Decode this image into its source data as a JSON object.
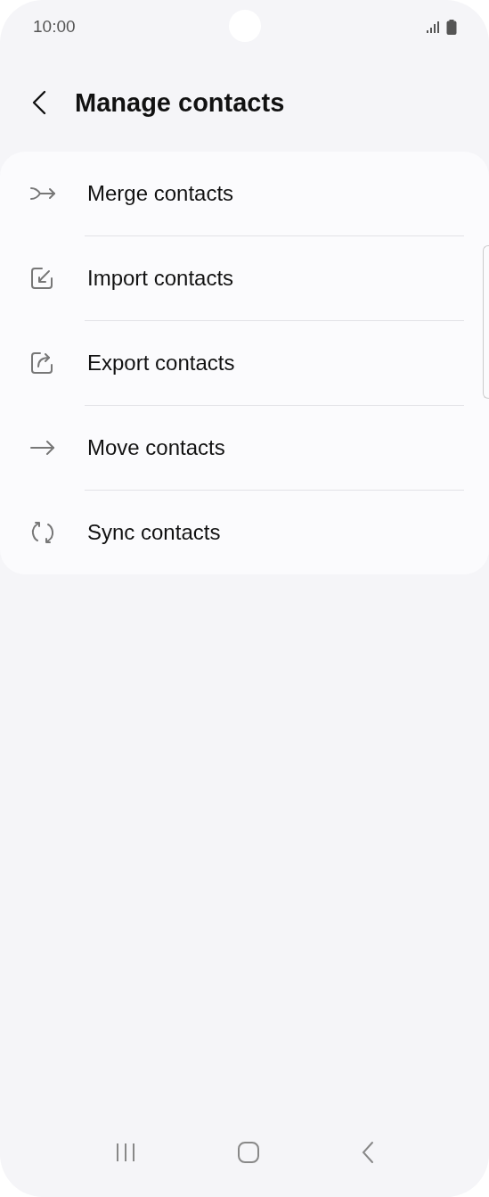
{
  "status_bar": {
    "time": "10:00"
  },
  "header": {
    "title": "Manage contacts"
  },
  "items": [
    {
      "kind": "merge",
      "label": "Merge contacts"
    },
    {
      "kind": "import",
      "label": "Import contacts"
    },
    {
      "kind": "export",
      "label": "Export contacts"
    },
    {
      "kind": "move",
      "label": "Move contacts"
    },
    {
      "kind": "sync",
      "label": "Sync contacts"
    }
  ]
}
